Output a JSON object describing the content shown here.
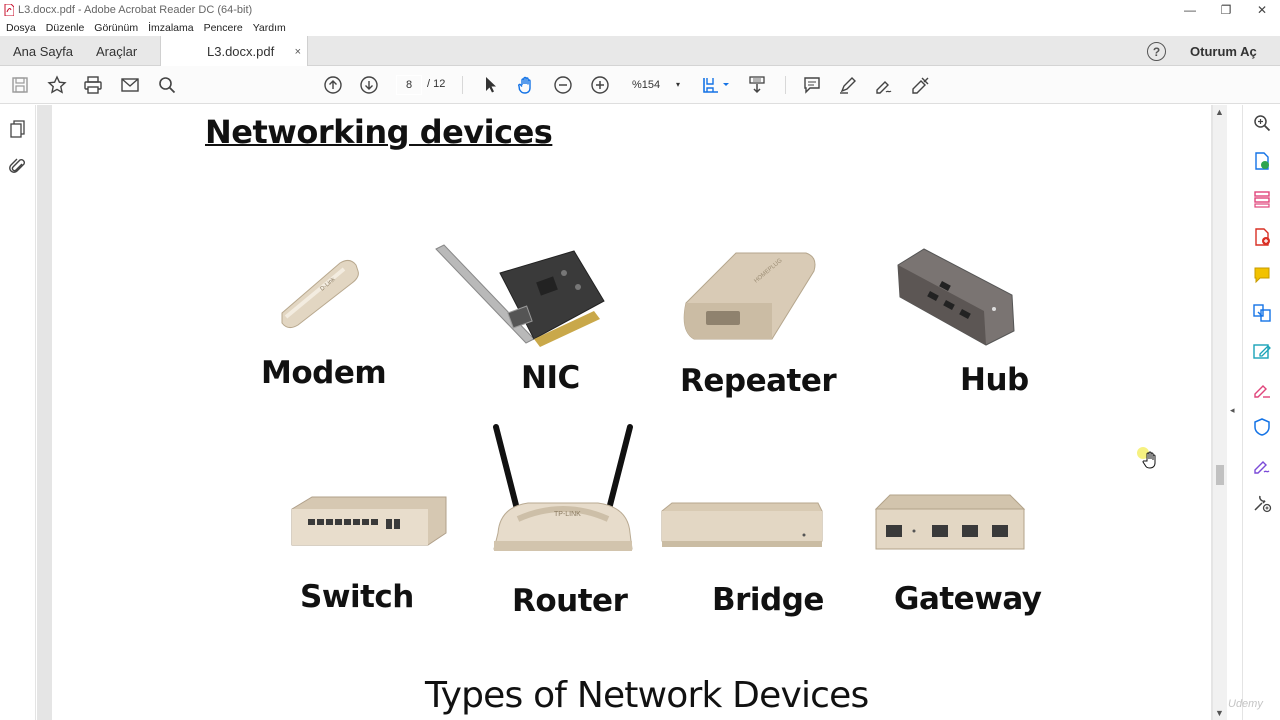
{
  "window": {
    "title": "L3.docx.pdf - Adobe Acrobat Reader DC (64-bit)",
    "minimize_glyph": "—",
    "maximize_glyph": "❐",
    "close_glyph": "✕"
  },
  "menu": {
    "items": [
      "Dosya",
      "Düzenle",
      "Görünüm",
      "İmzalama",
      "Pencere",
      "Yardım"
    ]
  },
  "tabs": {
    "home": "Ana Sayfa",
    "tools": "Araçlar",
    "document": "L3.docx.pdf",
    "close_glyph": "×"
  },
  "header": {
    "help_glyph": "?",
    "sign_in": "Oturum Aç"
  },
  "toolbar": {
    "current_page": "8",
    "total_pages": "/ 12",
    "zoom": "%154",
    "zoom_caret": "▾",
    "scroll_up": "▲",
    "scroll_down": "▼",
    "collapse_left": "◂",
    "collapse_right": "◂"
  },
  "document": {
    "heading": "Networking devices",
    "devices": [
      "Modem",
      "NIC",
      "Repeater",
      "Hub",
      "Switch",
      "Router",
      "Bridge",
      "Gateway"
    ],
    "subheading": "Types of Network Devices"
  },
  "watermark": "Udemy",
  "colors": {
    "accent_blue": "#1473e6",
    "device_beige": "#d9cbb6",
    "pcb_dark": "#3a3a3a"
  }
}
